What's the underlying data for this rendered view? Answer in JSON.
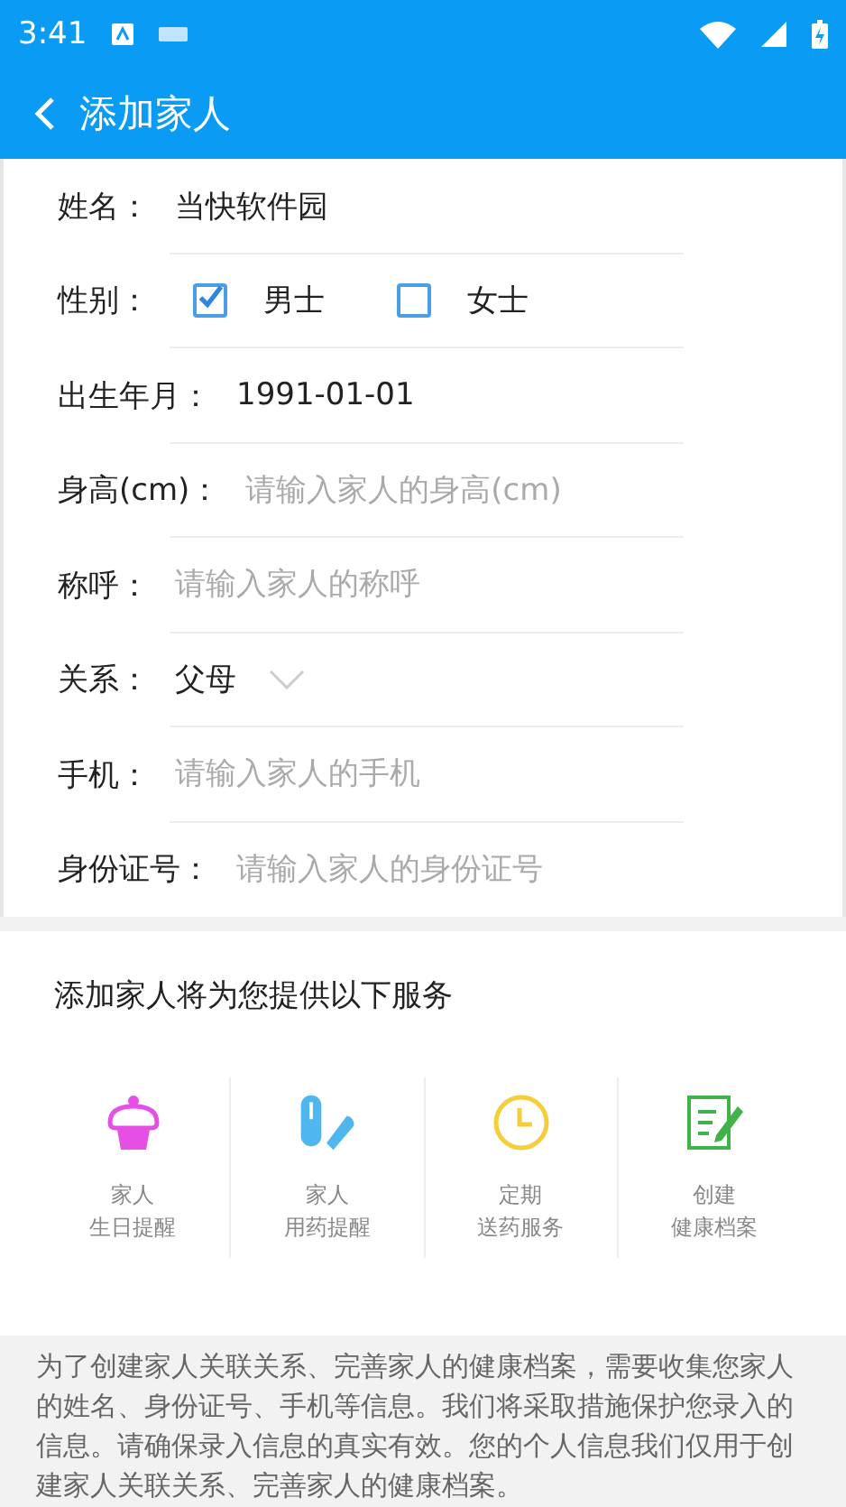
{
  "status_bar": {
    "time": "3:41"
  },
  "app_bar": {
    "title": "添加家人"
  },
  "form": [
    {
      "kind": "value",
      "label": "姓名：",
      "value": "当快软件园"
    },
    {
      "kind": "choice",
      "label": "性别：",
      "options": [
        {
          "label": "男士",
          "selected": true
        },
        {
          "label": "女士",
          "selected": false
        }
      ]
    },
    {
      "kind": "value",
      "label": "出生年月：",
      "value": "1991-01-01"
    },
    {
      "kind": "input",
      "label": "身高(cm)：",
      "placeholder": "请输入家人的身高(cm)"
    },
    {
      "kind": "input",
      "label": "称呼：",
      "placeholder": "请输入家人的称呼"
    },
    {
      "kind": "select",
      "label": "关系：",
      "value": "父母"
    },
    {
      "kind": "input",
      "label": "手机：",
      "placeholder": "请输入家人的手机"
    },
    {
      "kind": "input",
      "label": "身份证号：",
      "placeholder": "请输入家人的身份证号"
    }
  ],
  "services": {
    "title": "添加家人将为您提供以下服务",
    "items": [
      {
        "kind": "cake",
        "line1": "家人",
        "line2": "生日提醒"
      },
      {
        "kind": "pill",
        "line1": "家人",
        "line2": "用药提醒"
      },
      {
        "kind": "clock",
        "line1": "定期",
        "line2": "送药服务"
      },
      {
        "kind": "record",
        "line1": "创建",
        "line2": "健康档案"
      }
    ]
  },
  "notice": "为了创建家人关联关系、完善家人的健康档案，需要收集您家人的姓名、身份证号、手机等信息。我们将采取措施保护您录入的信息。请确保录入信息的真实有效。您的个人信息我们仅用于创建家人关联关系、完善家人的健康档案。"
}
